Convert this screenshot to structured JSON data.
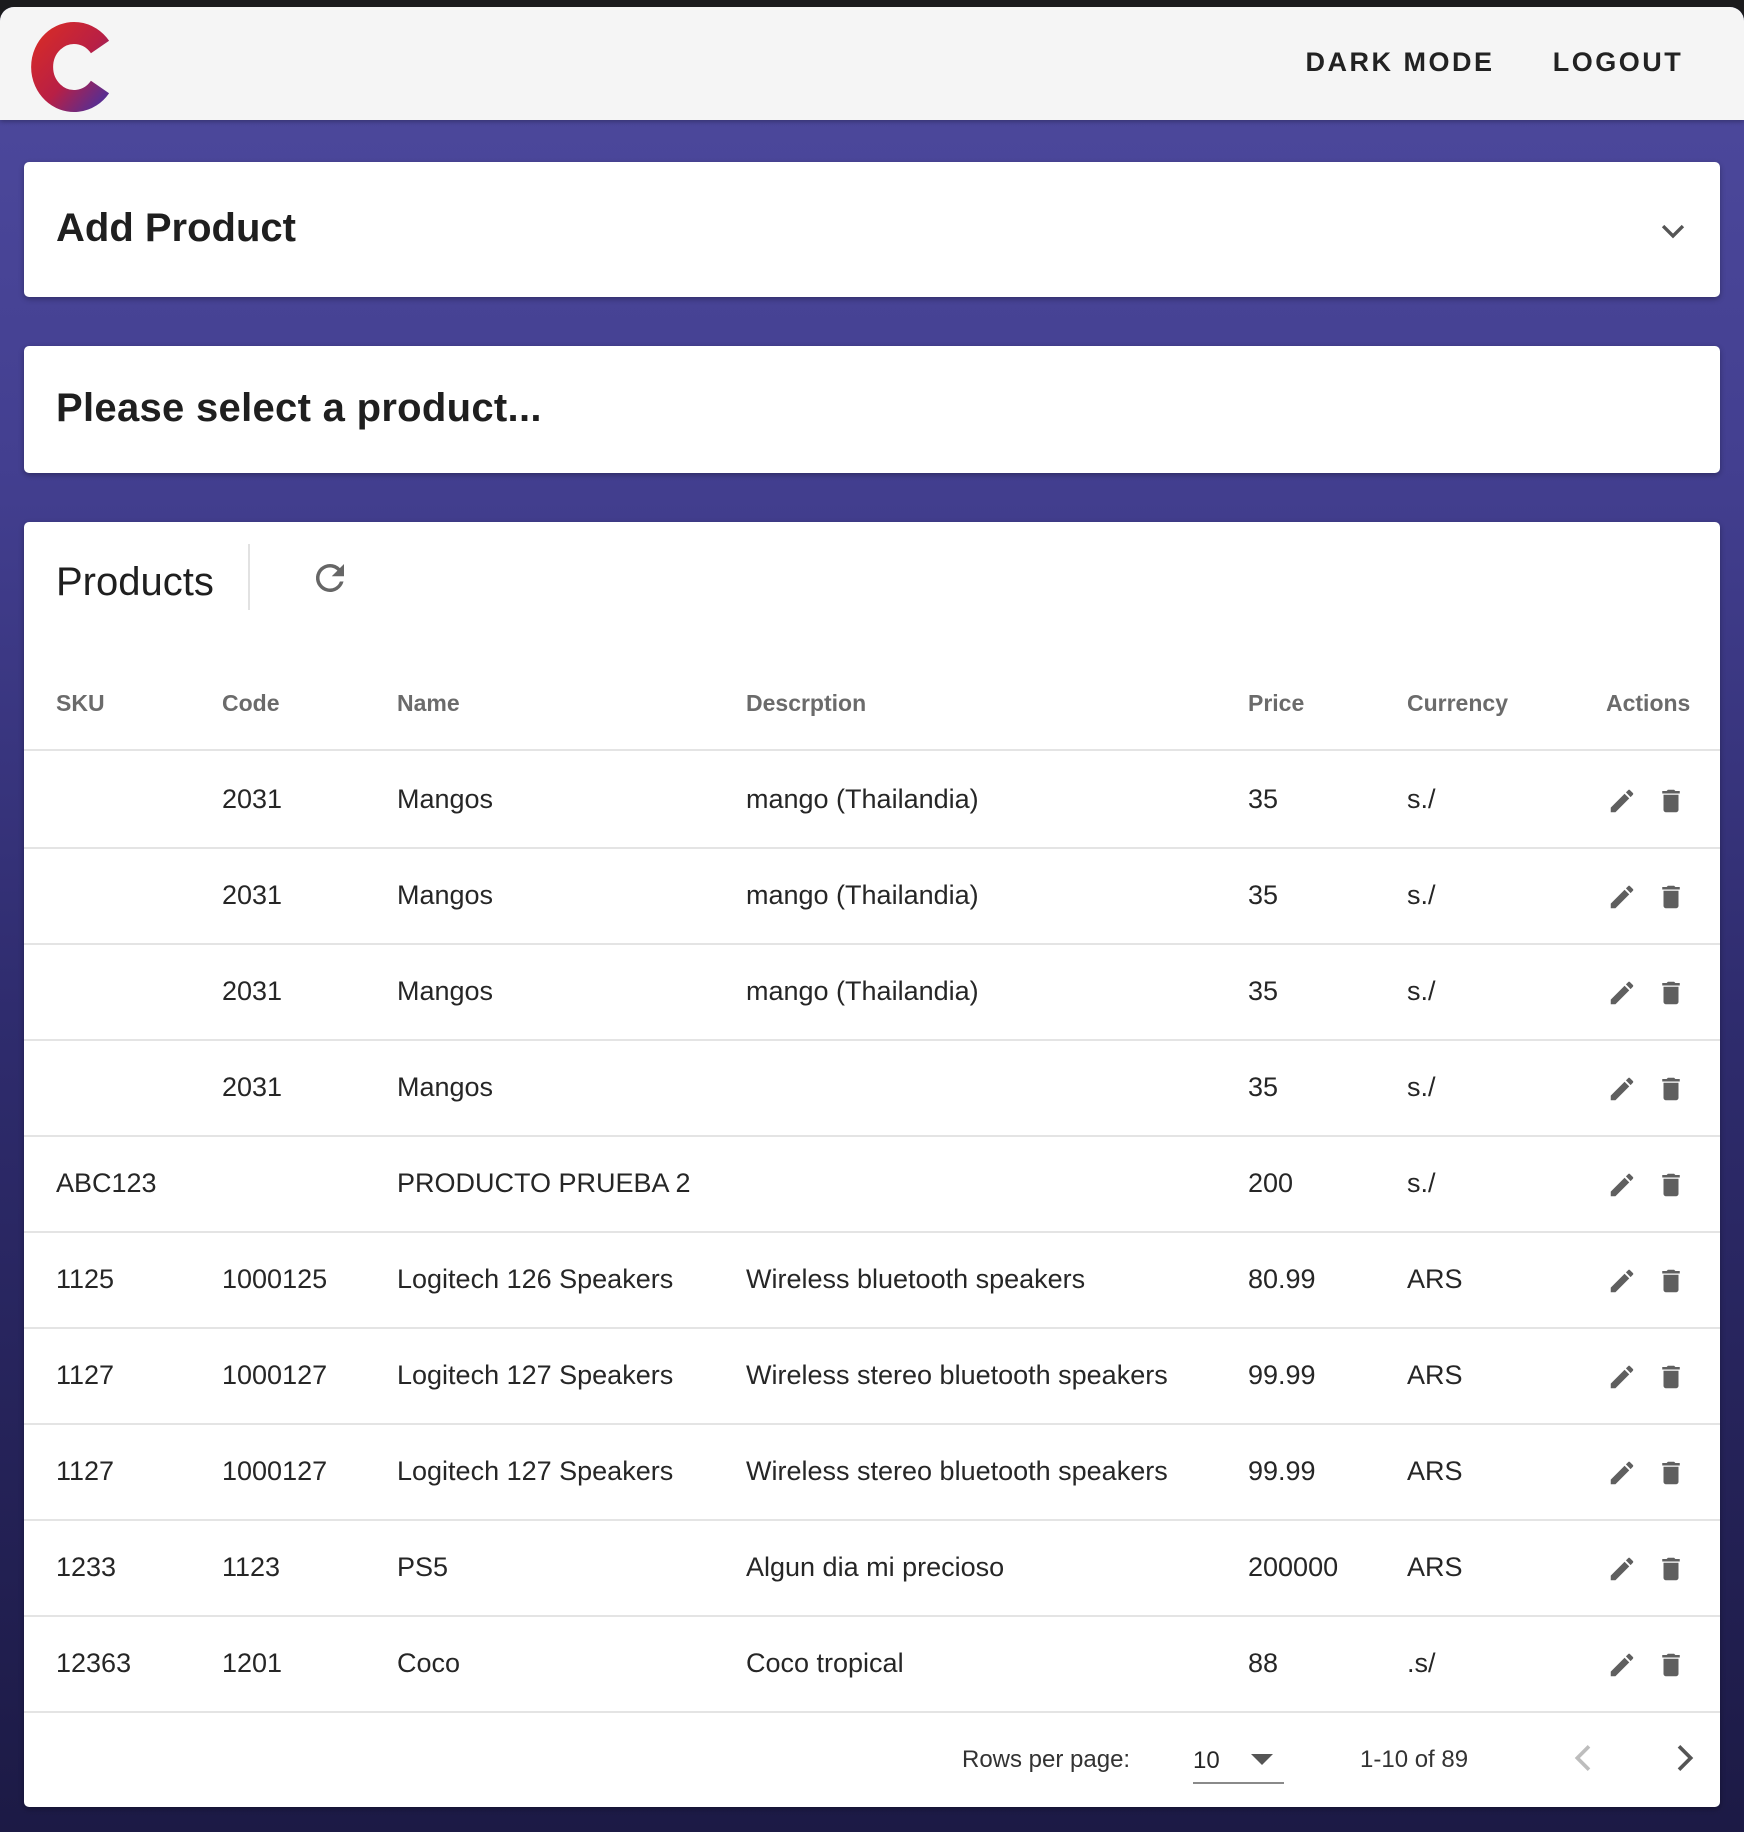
{
  "appbar": {
    "logo_icon": "c-logo-icon",
    "dark_mode_label": "DARK MODE",
    "logout_label": "LOGOUT"
  },
  "add_product": {
    "title": "Add Product",
    "expand_icon": "chevron-down-icon"
  },
  "selection": {
    "prompt": "Please select a product..."
  },
  "products": {
    "title": "Products",
    "refresh_icon": "refresh-icon",
    "columns": {
      "sku": "SKU",
      "code": "Code",
      "name": "Name",
      "description": "Descrption",
      "price": "Price",
      "currency": "Currency",
      "actions": "Actions"
    },
    "rows": [
      {
        "sku": "",
        "code": "2031",
        "name": "Mangos",
        "description": "mango (Thailandia)",
        "price": "35",
        "currency": "s./"
      },
      {
        "sku": "",
        "code": "2031",
        "name": "Mangos",
        "description": "mango (Thailandia)",
        "price": "35",
        "currency": "s./"
      },
      {
        "sku": "",
        "code": "2031",
        "name": "Mangos",
        "description": "mango (Thailandia)",
        "price": "35",
        "currency": "s./"
      },
      {
        "sku": "",
        "code": "2031",
        "name": "Mangos",
        "description": "",
        "price": "35",
        "currency": "s./"
      },
      {
        "sku": "ABC123",
        "code": "",
        "name": "PRODUCTO PRUEBA 2",
        "description": "",
        "price": "200",
        "currency": "s./"
      },
      {
        "sku": "1125",
        "code": "1000125",
        "name": "Logitech 126 Speakers",
        "description": "Wireless bluetooth speakers",
        "price": "80.99",
        "currency": "ARS"
      },
      {
        "sku": "1127",
        "code": "1000127",
        "name": "Logitech 127 Speakers",
        "description": "Wireless stereo bluetooth speakers",
        "price": "99.99",
        "currency": "ARS"
      },
      {
        "sku": "1127",
        "code": "1000127",
        "name": "Logitech 127 Speakers",
        "description": "Wireless stereo bluetooth speakers",
        "price": "99.99",
        "currency": "ARS"
      },
      {
        "sku": "1233",
        "code": "1123",
        "name": "PS5",
        "description": "Algun dia mi precioso",
        "price": "200000",
        "currency": "ARS"
      },
      {
        "sku": "12363",
        "code": "1201",
        "name": "Coco",
        "description": "Coco tropical",
        "price": "88",
        "currency": ".s/"
      }
    ],
    "row_actions": {
      "edit_icon": "pencil-icon",
      "delete_icon": "trash-icon"
    },
    "pagination": {
      "rows_per_page_label": "Rows per page:",
      "rows_per_page_value": "10",
      "range_text": "1-10 of 89",
      "prev_icon": "chevron-left-icon",
      "next_icon": "chevron-right-icon"
    }
  },
  "colors": {
    "background_top": "#4e4a9e",
    "background_bottom": "#1c1a45",
    "logo_red": "#c4222e",
    "logo_purple": "#5b2d8f"
  }
}
